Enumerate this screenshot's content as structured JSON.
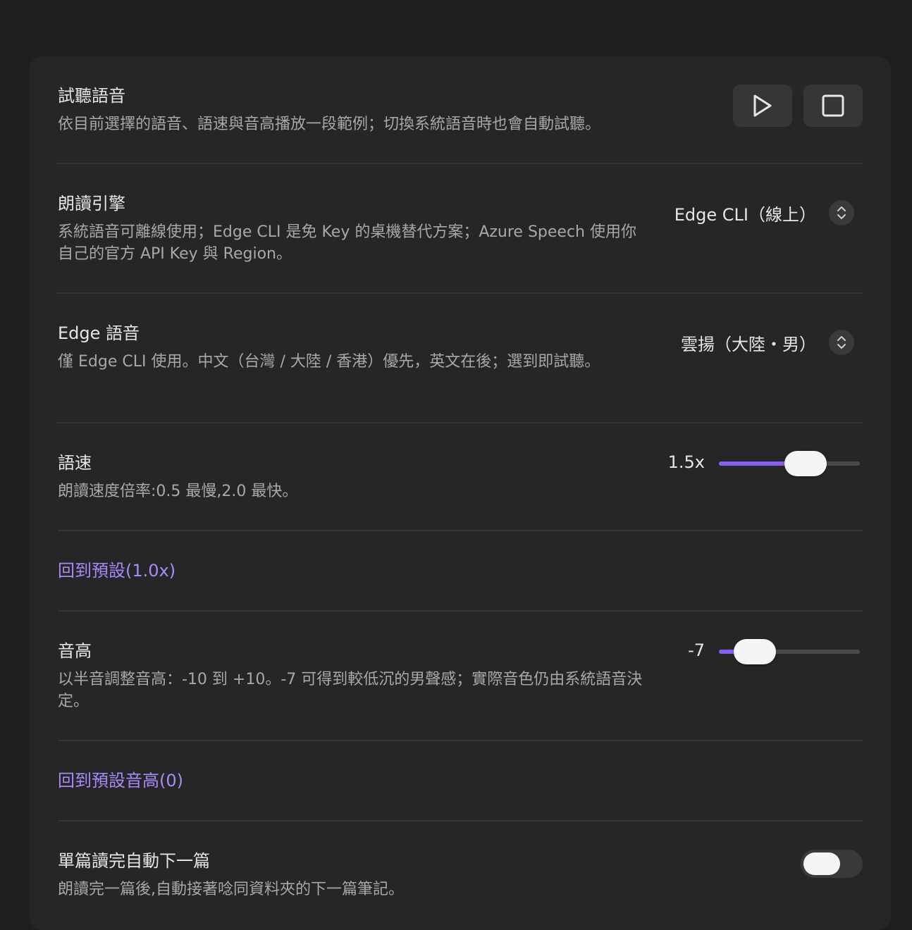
{
  "preview": {
    "title": "試聽語音",
    "desc": "依目前選擇的語音、語速與音高播放一段範例；切換系統語音時也會自動試聽。",
    "play_icon": "play-icon",
    "stop_icon": "stop-icon"
  },
  "engine": {
    "title": "朗讀引擎",
    "desc": "系統語音可離線使用；Edge CLI 是免 Key 的桌機替代方案；Azure Speech 使用你自己的官方 API Key 與 Region。",
    "selected": "Edge CLI（線上）"
  },
  "edge_voice": {
    "title": "Edge 語音",
    "desc": "僅 Edge CLI 使用。中文（台灣 / 大陸 / 香港）優先，英文在後；選到即試聽。",
    "selected": "雲揚（大陸・男）"
  },
  "rate": {
    "title": "語速",
    "desc": "朗讀速度倍率:0.5 最慢,2.0 最快。",
    "value_label": "1.5x",
    "value": 1.5,
    "min": 0.5,
    "max": 2.0
  },
  "rate_reset": {
    "label": "回到預設(1.0x)"
  },
  "pitch": {
    "title": "音高",
    "desc": "以半音調整音高：-10 到 +10。-7 可得到較低沉的男聲感；實際音色仍由系統語音決定。",
    "value_label": "-7",
    "value": -7,
    "min": -10,
    "max": 10
  },
  "pitch_reset": {
    "label": "回到預設音高(0)"
  },
  "auto_next": {
    "title": "單篇讀完自動下一篇",
    "desc": "朗讀完一篇後,自動接著唸同資料夾的下一篇筆記。",
    "enabled": false
  },
  "colors": {
    "accent": "#8b5cf6",
    "link": "#a78bfa",
    "panel": "#262626",
    "background": "#1e1e1e"
  }
}
